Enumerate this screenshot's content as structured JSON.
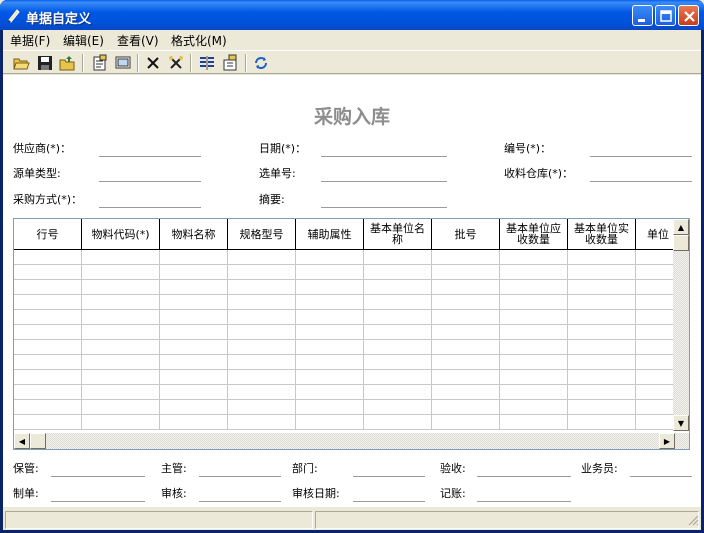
{
  "window": {
    "title": "单据自定义",
    "colors": {
      "titlebar": "#0058E6",
      "close_button": "#C73E1B",
      "form_title": "#8D8D8D"
    }
  },
  "menubar": {
    "items": [
      {
        "label": "单据(F)"
      },
      {
        "label": "编辑(E)"
      },
      {
        "label": "查看(V)"
      },
      {
        "label": "格式化(M)"
      }
    ]
  },
  "toolbar": {
    "icons": [
      "open-folder-icon",
      "save-icon",
      "folder-up-icon",
      "properties-icon",
      "preview-icon",
      "delete-icon",
      "cut-icon",
      "align-icon",
      "settings-icon",
      "refresh-icon"
    ]
  },
  "form": {
    "title": "采购入库",
    "fields": {
      "supplier": "供应商(*)：",
      "date": "日期(*)：",
      "number": "编号(*)：",
      "source_type": "源单类型:",
      "select_no": "选单号:",
      "warehouse": "收料仓库(*)：",
      "purchase_method": "采购方式(*)：",
      "summary": "摘要:"
    }
  },
  "grid": {
    "columns": [
      {
        "label": "行号"
      },
      {
        "label": "物料代码(*)"
      },
      {
        "label": "物料名称"
      },
      {
        "label": "规格型号"
      },
      {
        "label": "辅助属性"
      },
      {
        "label": "基本单位名称"
      },
      {
        "label": "批号"
      },
      {
        "label": "基本单位应收数量"
      },
      {
        "label": "基本单位实收数量"
      },
      {
        "label": "单位"
      }
    ],
    "empty_rows": 12
  },
  "footer": {
    "keeper": "保管:",
    "supervisor": "主管:",
    "department": "部门:",
    "inspection": "验收:",
    "salesperson": "业务员:",
    "preparer": "制单:",
    "reviewer": "审核:",
    "review_date": "审核日期:",
    "bookkeeper": "记账:"
  }
}
